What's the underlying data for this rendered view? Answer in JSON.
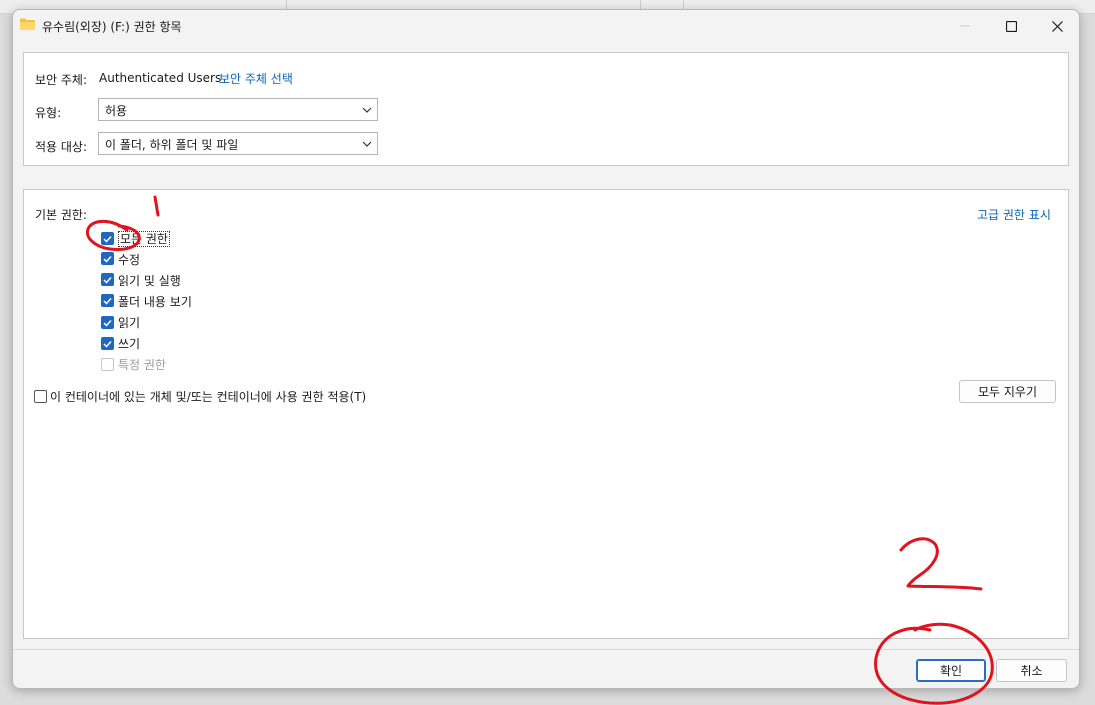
{
  "window": {
    "title": "유수림(외장) (F:) 권한 항목"
  },
  "top_panel": {
    "principal_label": "보안 주체:",
    "principal_value": "Authenticated Users",
    "select_principal_link": "보안 주체 선택",
    "type_label": "유형:",
    "type_value": "허용",
    "applies_label": "적용 대상:",
    "applies_value": "이 폴더, 하위 폴더 및 파일"
  },
  "permissions": {
    "heading": "기본 권한:",
    "advanced_link": "고급 권한 표시",
    "items": [
      {
        "label": "모든 권한",
        "checked": true
      },
      {
        "label": "수정",
        "checked": true
      },
      {
        "label": "읽기 및 실행",
        "checked": true
      },
      {
        "label": "폴더 내용 보기",
        "checked": true
      },
      {
        "label": "읽기",
        "checked": true
      },
      {
        "label": "쓰기",
        "checked": true
      },
      {
        "label": "특정 권한",
        "checked": false
      }
    ],
    "apply_container_label": "이 컨테이너에 있는 개체 및/또는 컨테이너에 사용 권한 적용(T)",
    "apply_container_checked": false,
    "clear_all_label": "모두 지우기"
  },
  "footer": {
    "ok_label": "확인",
    "cancel_label": "취소"
  },
  "annotations": {
    "mark_1": "1",
    "mark_2": "2",
    "color": "#e0141e"
  },
  "colors": {
    "accent": "#1f67c0",
    "link": "#0a64b4"
  }
}
